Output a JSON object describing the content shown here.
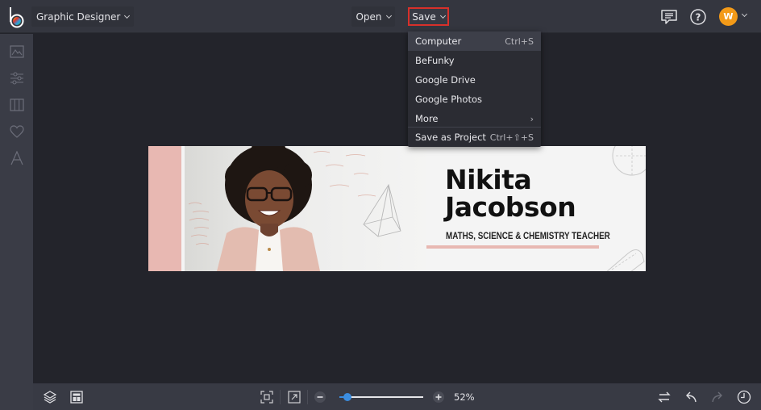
{
  "topbar": {
    "app_menu_label": "Graphic Designer",
    "open_label": "Open",
    "save_label": "Save",
    "avatar_initial": "W",
    "icons": [
      "chat-icon",
      "help-icon"
    ]
  },
  "colors": {
    "accent": "#3b8de0",
    "save_highlight": "#d8302a",
    "avatar": "#f39a18",
    "banner_pink": "#e8b8b2"
  },
  "sidebar": {
    "items": [
      {
        "icon": "image-icon"
      },
      {
        "icon": "adjust-sliders-icon"
      },
      {
        "icon": "layout-columns-icon"
      },
      {
        "icon": "heart-icon"
      },
      {
        "icon": "text-icon"
      }
    ]
  },
  "save_menu": {
    "items": [
      {
        "label": "Computer",
        "shortcut": "Ctrl+S"
      },
      {
        "label": "BeFunky",
        "shortcut": ""
      },
      {
        "label": "Google Drive",
        "shortcut": ""
      },
      {
        "label": "Google Photos",
        "shortcut": ""
      },
      {
        "label": "More",
        "shortcut": "›"
      },
      {
        "label": "Save as Project",
        "shortcut": "Ctrl+⇧+S"
      }
    ]
  },
  "banner": {
    "name_line1": "Nikita",
    "name_line2": "Jacobson",
    "subtitle": "MATHS, SCIENCE & CHEMISTRY TEACHER"
  },
  "bottombar": {
    "zoom_percent": 52,
    "zoom_label": "52%",
    "zoom_slider_fraction": 0.1
  }
}
